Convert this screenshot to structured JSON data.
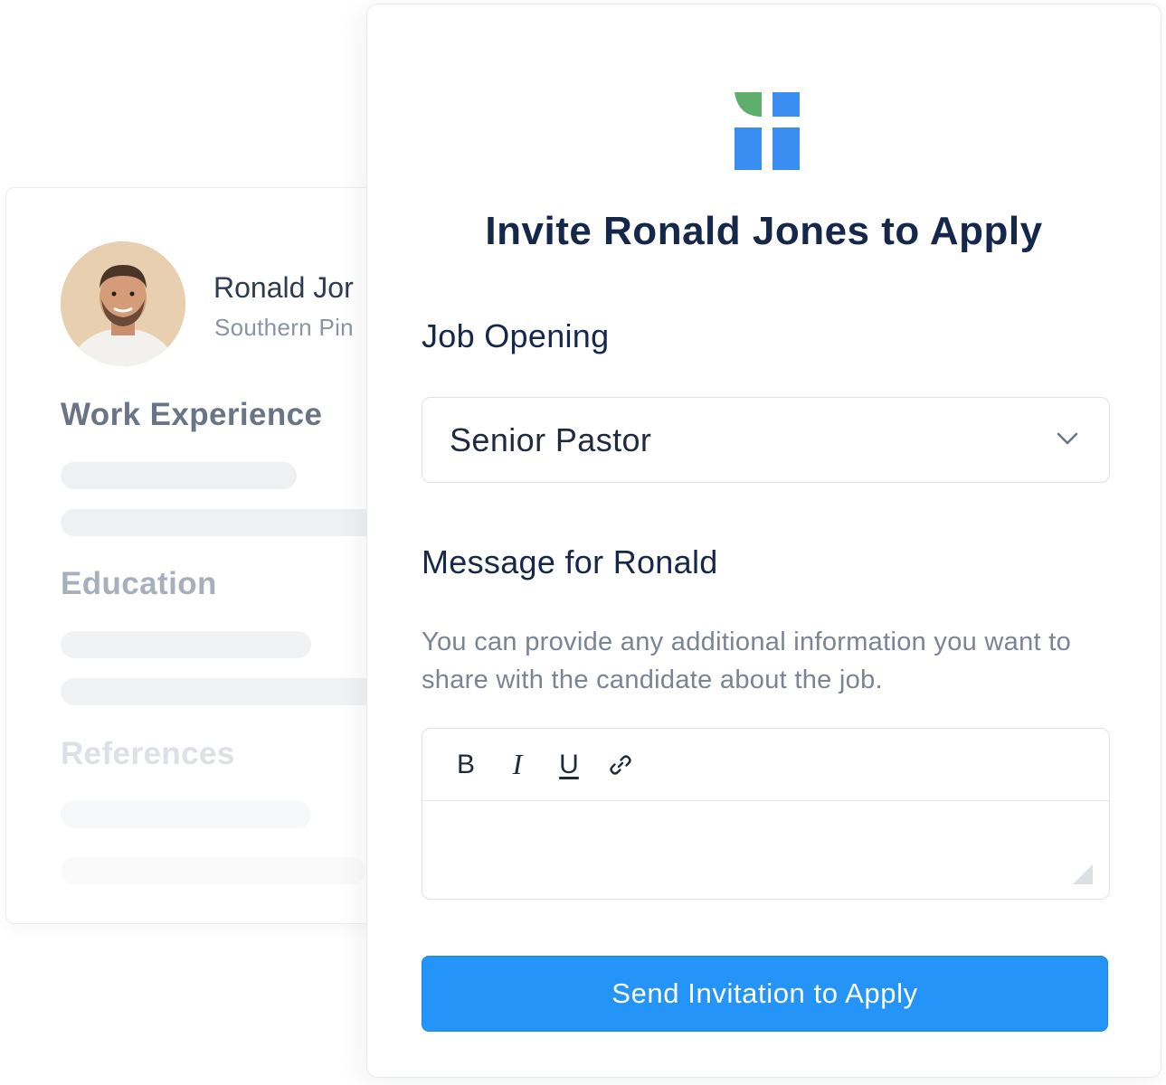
{
  "profile": {
    "name": "Ronald Jor",
    "location": "Southern Pin",
    "sections": {
      "work": "Work Experience",
      "education": "Education",
      "references": "References"
    }
  },
  "modal": {
    "title": "Invite Ronald Jones to Apply",
    "job_opening": {
      "label": "Job Opening",
      "selected": "Senior Pastor"
    },
    "message": {
      "label": "Message for Ronald",
      "help": "You can provide any additional information you want to share with the candidate about the job.",
      "toolbar": {
        "bold": "B",
        "italic": "I",
        "underline": "U",
        "link_icon": "link-icon"
      },
      "value": ""
    },
    "submit_label": "Send Invitation to Apply"
  },
  "colors": {
    "primary": "#2594f9",
    "title": "#15274a",
    "logo_blue": "#3a8ef2",
    "logo_green": "#5fae6b"
  }
}
